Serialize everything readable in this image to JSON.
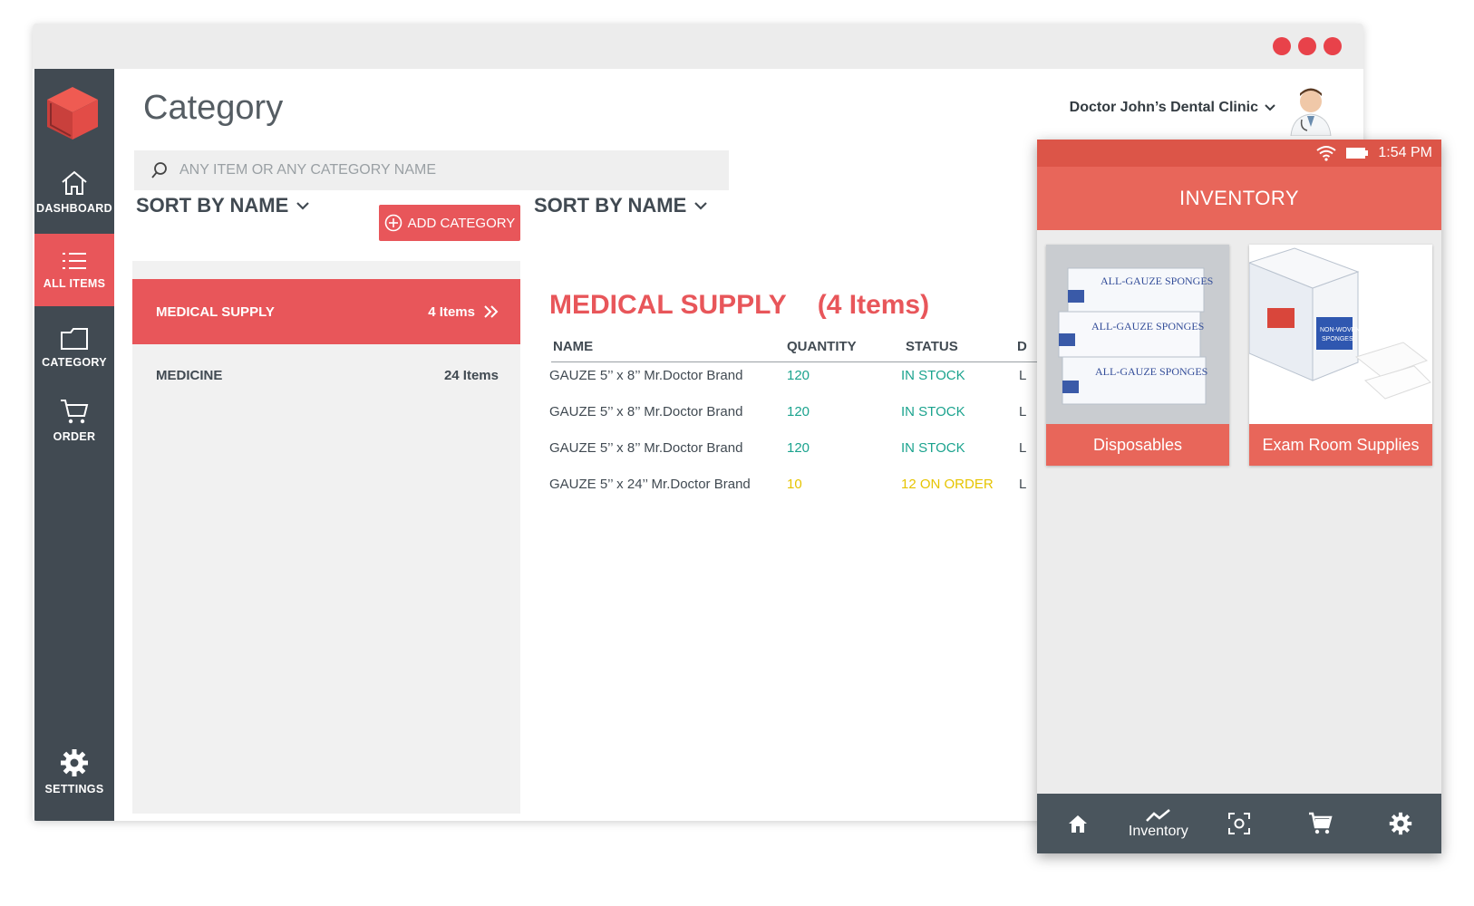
{
  "window": {
    "title": "Category",
    "clinic_name": "Doctor John’s Dental Clinic"
  },
  "sidebar": {
    "items": [
      {
        "label": "DASHBOARD",
        "icon": "home-icon"
      },
      {
        "label": "ALL ITEMS",
        "icon": "list-icon",
        "active": true
      },
      {
        "label": "CATEGORY",
        "icon": "folder-icon"
      },
      {
        "label": "ORDER",
        "icon": "cart-icon"
      },
      {
        "label": "SETTINGS",
        "icon": "gear-icon"
      }
    ]
  },
  "search": {
    "placeholder": "ANY ITEM OR ANY CATEGORY NAME"
  },
  "left_sort": {
    "label": "SORT BY NAME"
  },
  "right_sort": {
    "label": "SORT BY NAME"
  },
  "add_category": {
    "label": "ADD CATEGORY"
  },
  "categories": [
    {
      "name": "MEDICAL SUPPLY",
      "count": "4 Items",
      "active": true
    },
    {
      "name": "MEDICINE",
      "count": "24 Items"
    }
  ],
  "detail": {
    "title": "MEDICAL SUPPLY",
    "count": "(4 Items)",
    "columns": [
      "NAME",
      "QUANTITY",
      "STATUS",
      "D"
    ],
    "rows": [
      {
        "name": "GAUZE 5’’ x 8’’  Mr.Doctor Brand",
        "quantity": "120",
        "status": "IN STOCK",
        "extra": "L"
      },
      {
        "name": "GAUZE 5’’ x 8’’  Mr.Doctor Brand",
        "quantity": "120",
        "status": "IN STOCK",
        "extra": "L"
      },
      {
        "name": "GAUZE 5’’ x 8’’  Mr.Doctor Brand",
        "quantity": "120",
        "status": "IN STOCK",
        "extra": "L"
      },
      {
        "name": "GAUZE 5’’ x 24’’  Mr.Doctor Brand",
        "quantity": "10",
        "status": "12 ON ORDER",
        "extra": "L"
      }
    ]
  },
  "mobile": {
    "time": "1:54 PM",
    "app_title": "INVENTORY",
    "cards": [
      {
        "label": "Disposables"
      },
      {
        "label": "Exam Room Supplies"
      }
    ],
    "nav": [
      {
        "icon": "home-icon",
        "label": ""
      },
      {
        "icon": "trend-icon",
        "label": "Inventory"
      },
      {
        "icon": "scan-icon",
        "label": ""
      },
      {
        "icon": "cart-icon",
        "label": ""
      },
      {
        "icon": "gear-icon",
        "label": ""
      }
    ]
  },
  "colors": {
    "accent": "#e8565a",
    "sidebar": "#414a52",
    "in_stock": "#1ba38e",
    "on_order": "#e6c400"
  }
}
